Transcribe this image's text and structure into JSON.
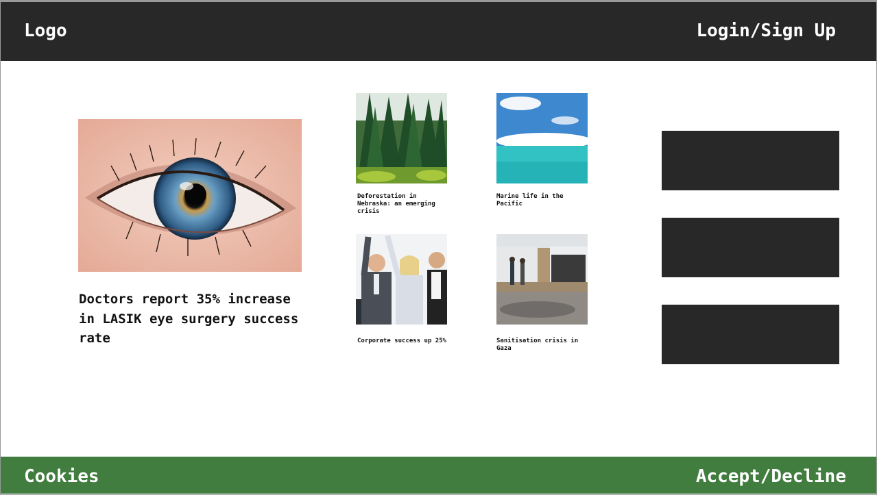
{
  "header": {
    "logo": "Logo",
    "login": "Login/Sign Up"
  },
  "feature": {
    "title": "Doctors report 35% increase in LASIK eye surgery success rate",
    "image": "eye-closeup-image"
  },
  "articles": [
    {
      "caption": "Deforestation in Nebraska: an emerging crisis",
      "image": "forest-image"
    },
    {
      "caption": "Marine life in the Pacific",
      "image": "ocean-image"
    },
    {
      "caption": "Corporate success up 25%",
      "image": "office-celebration-image"
    },
    {
      "caption": "Sanitisation crisis in Gaza",
      "image": "flooded-camp-image"
    }
  ],
  "footer": {
    "cookies": "Cookies",
    "accept": "Accept/Decline"
  },
  "colors": {
    "header": "#282828",
    "footer": "#407d3e",
    "ad_block": "#282828"
  }
}
